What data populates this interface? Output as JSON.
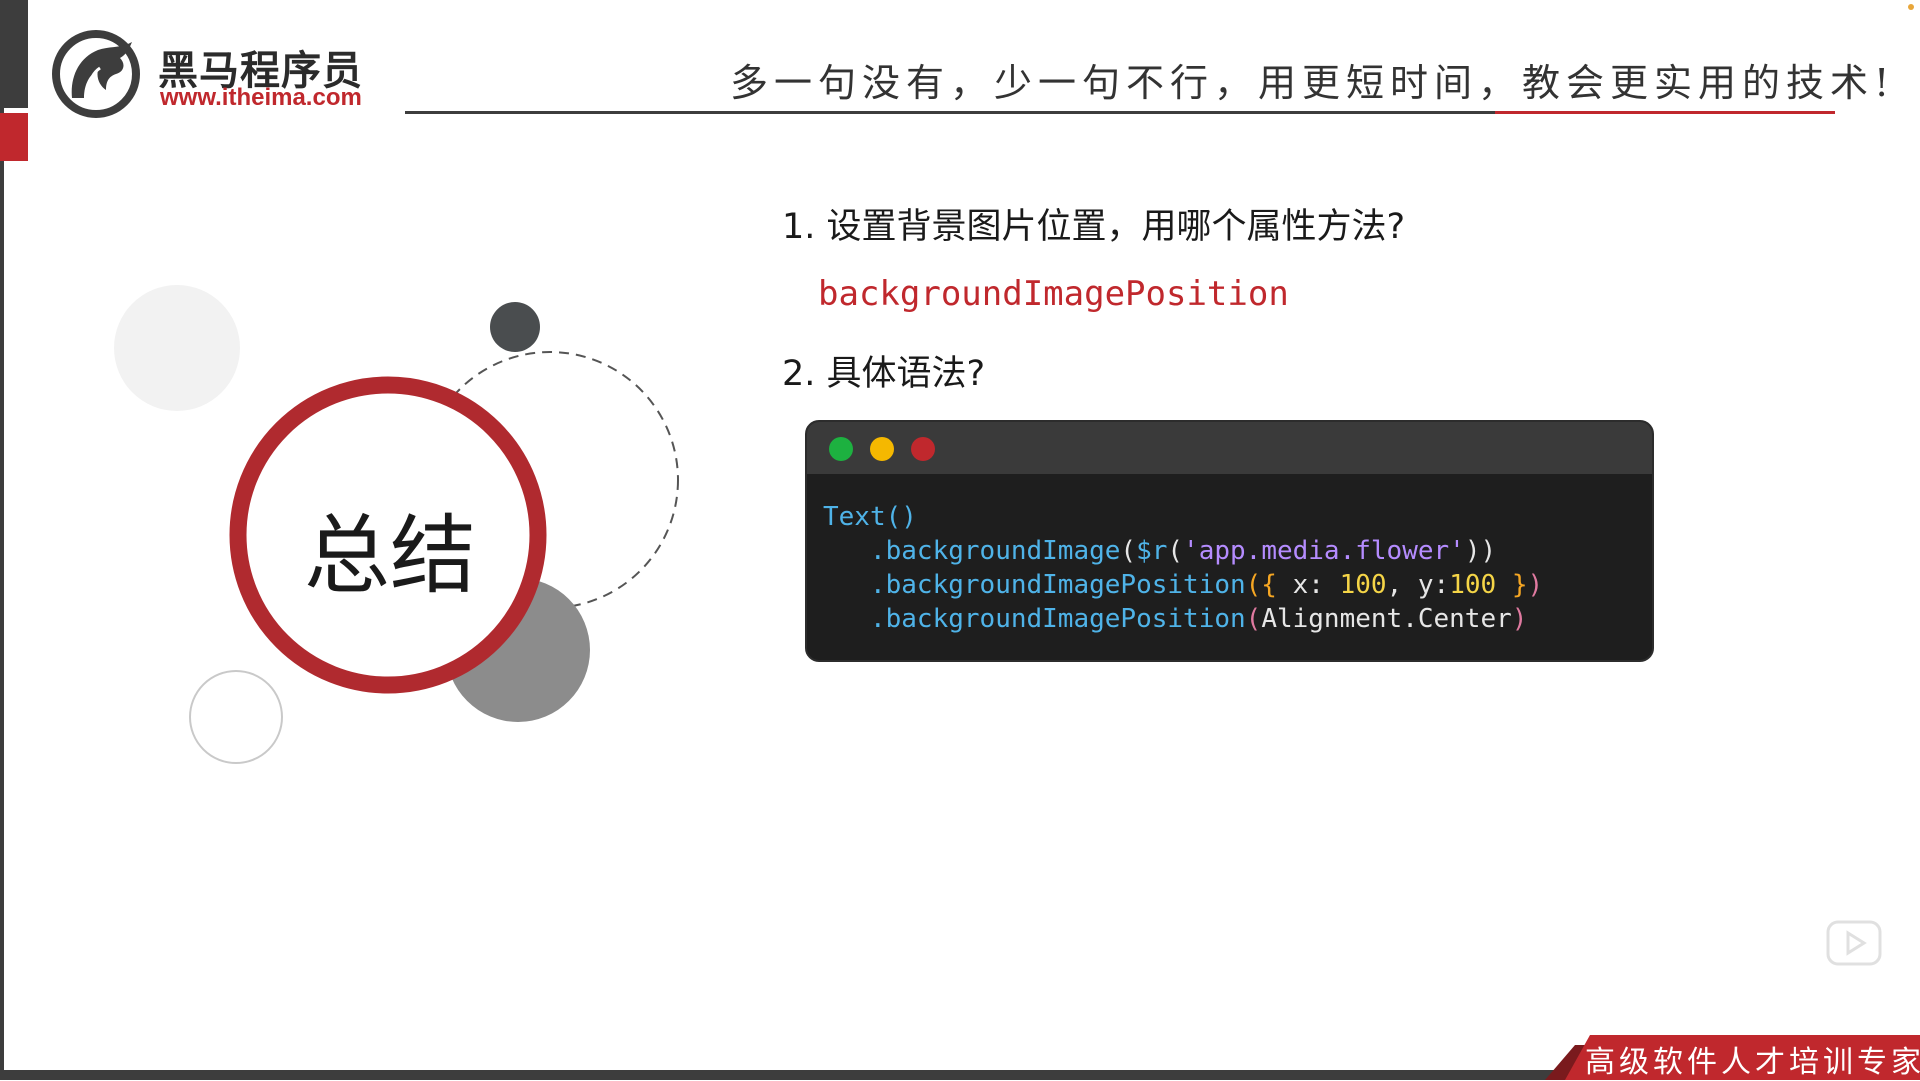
{
  "brand": {
    "name_cn": "黑马程序员",
    "url": "www.itheima.com",
    "slogan": "多一句没有，少一句不行，用更短时间，教会更实用的技术!",
    "footer_tagline": "高级软件人才培训专家"
  },
  "colors": {
    "accent_red": "#c0282d",
    "dark_gray": "#3d3d3d",
    "code_bg": "#1e1e1e"
  },
  "summary": {
    "title": "总结"
  },
  "questions": [
    {
      "text": "1. 设置背景图片位置，用哪个属性方法?",
      "answer": "backgroundImagePosition"
    },
    {
      "text": "2. 具体语法?"
    }
  ],
  "code": {
    "line1": "Text()",
    "line2_method": ".backgroundImage",
    "line2_args": "($r('app.media.flower'))",
    "line2_fn": "$r",
    "line2_str": "'app.media.flower'",
    "line3_method": ".backgroundImagePosition",
    "line3_x_key": "x:",
    "line3_x_val": "100",
    "line3_y_key": "y:",
    "line3_y_val": "100",
    "line4_method": ".backgroundImagePosition",
    "line4_arg": "Alignment.Center"
  },
  "icons": {
    "logo": "horse-logo-icon",
    "play": "play-icon"
  }
}
